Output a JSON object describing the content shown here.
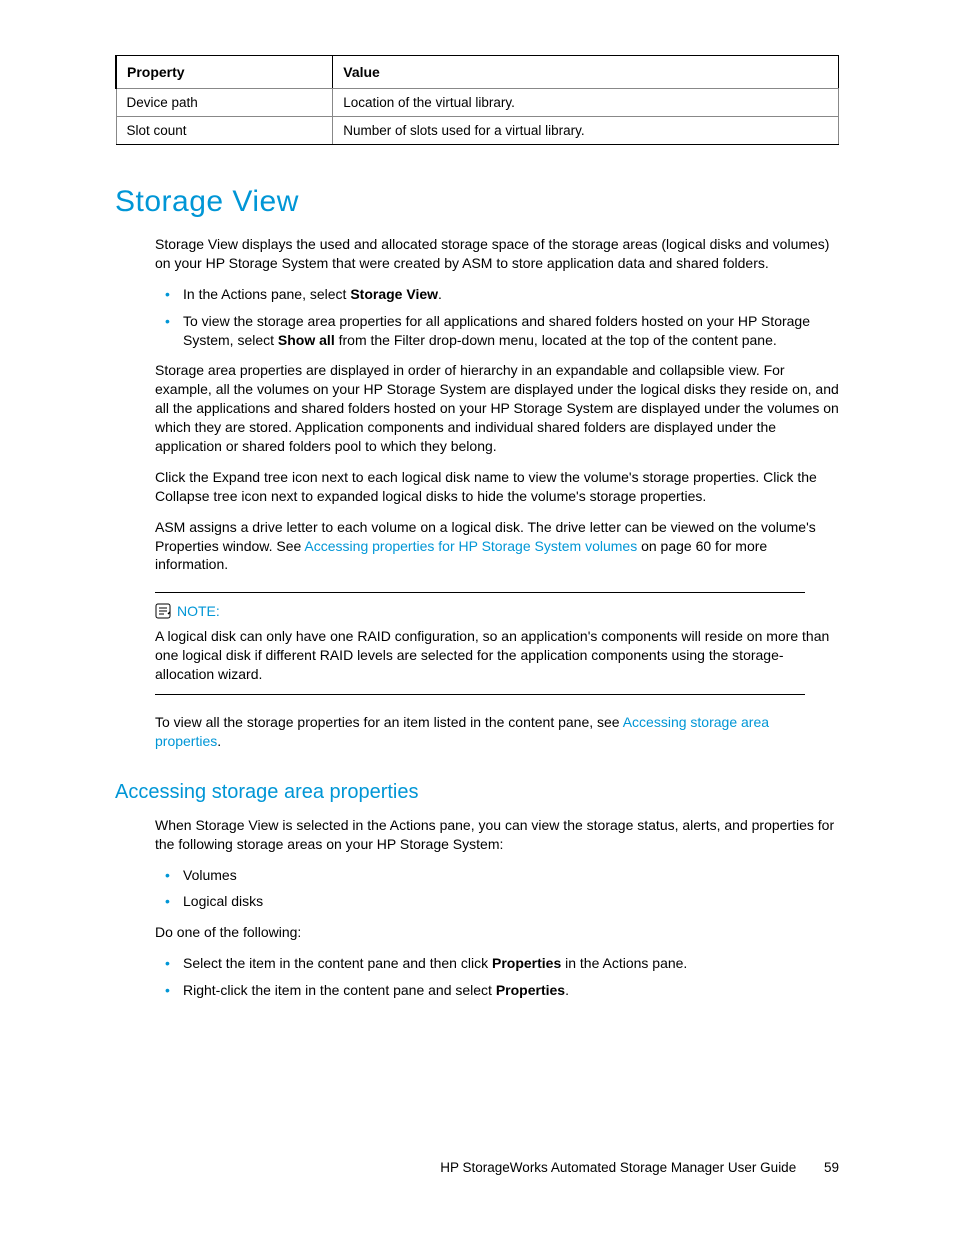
{
  "table": {
    "headers": [
      "Property",
      "Value"
    ],
    "rows": [
      [
        "Device path",
        "Location of the virtual library."
      ],
      [
        "Slot count",
        "Number of slots used for a virtual library."
      ]
    ]
  },
  "h1": "Storage View",
  "intro_p": "Storage View displays the used and allocated storage space of the storage areas (logical disks and volumes) on your HP Storage System that were created by ASM to store application data and shared folders.",
  "bullets1": {
    "b0_pre": "In the Actions pane, select ",
    "b0_bold": "Storage View",
    "b0_post": ".",
    "b1_pre": "To view the storage area properties for all applications and shared folders hosted on your HP Storage System, select ",
    "b1_bold": "Show all",
    "b1_post": " from the Filter drop-down menu, located at the top of the content pane."
  },
  "para2": "Storage area properties are displayed in order of hierarchy in an expandable and collapsible view. For example, all the volumes on your HP Storage System are displayed under the logical disks they reside on, and all the applications and shared folders hosted on your HP Storage System are displayed under the volumes on which they are stored. Application components and individual shared folders are displayed under the application or shared folders pool to which they belong.",
  "para3": "Click the Expand tree icon next to each logical disk name to view the volume's storage properties. Click the Collapse tree icon next to expanded logical disks to hide the volume's storage properties.",
  "para4_pre": "ASM assigns a drive letter to each volume on a logical disk. The drive letter can be viewed on the volume's Properties window. See ",
  "para4_link": "Accessing properties for HP Storage System volumes",
  "para4_post": " on page 60 for more information.",
  "note_label": "NOTE:",
  "note_body": "A logical disk can only have one RAID configuration, so an application's components will reside on more than one logical disk if different RAID levels are selected for the application components using the storage-allocation wizard.",
  "para5_pre": "To view all the storage properties for an item listed in the content pane, see ",
  "para5_link": "Accessing storage area properties",
  "para5_post": ".",
  "h2": "Accessing storage area properties",
  "sec2_intro": "When Storage View is selected in the Actions pane, you can view the storage status, alerts, and properties for the following storage areas on your HP Storage System:",
  "sec2_list1": [
    "Volumes",
    "Logical disks"
  ],
  "sec2_do": "Do one of the following:",
  "sec2_list2": {
    "b0_pre": "Select the item in the content pane and then click ",
    "b0_bold": "Properties",
    "b0_post": " in the Actions pane.",
    "b1_pre": "Right-click the item in the content pane and select ",
    "b1_bold": "Properties",
    "b1_post": "."
  },
  "footer_title": "HP StorageWorks Automated Storage Manager User Guide",
  "footer_page": "59"
}
